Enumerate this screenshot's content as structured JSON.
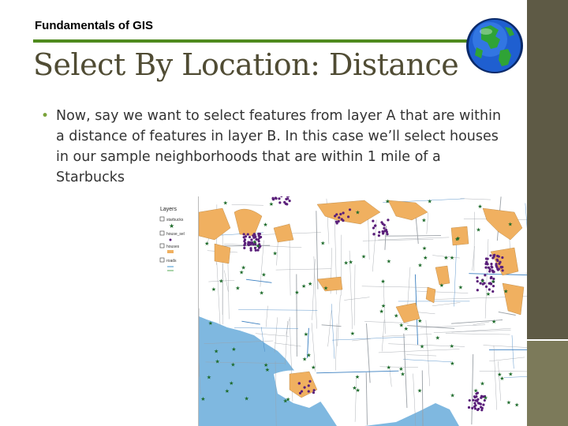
{
  "header": {
    "course": "Fundamentals of GIS",
    "title": "Select By Location: Distance"
  },
  "body": {
    "bullet": "Now, say we want to select features from layer A that are within a distance  of features in layer B. In this case we’ll select houses in our sample neighborhoods that are within 1 mile of a Starbucks"
  },
  "toc": {
    "heading": "Layers",
    "layers": [
      "starbucks",
      "house_sel",
      "houses",
      "roads"
    ]
  },
  "colors": {
    "accent_rule": "#4f8a1e",
    "title": "#504c34",
    "sidebar": "#5e5a45",
    "water": "#7fb8e0",
    "land": "#ffffff",
    "parks": "#f0b060",
    "selected_houses": "#5a1f7a",
    "starbucks": "#1d6b2a"
  },
  "icons": {
    "logo": "globe-icon",
    "layer_symbol_1": "star-icon"
  }
}
